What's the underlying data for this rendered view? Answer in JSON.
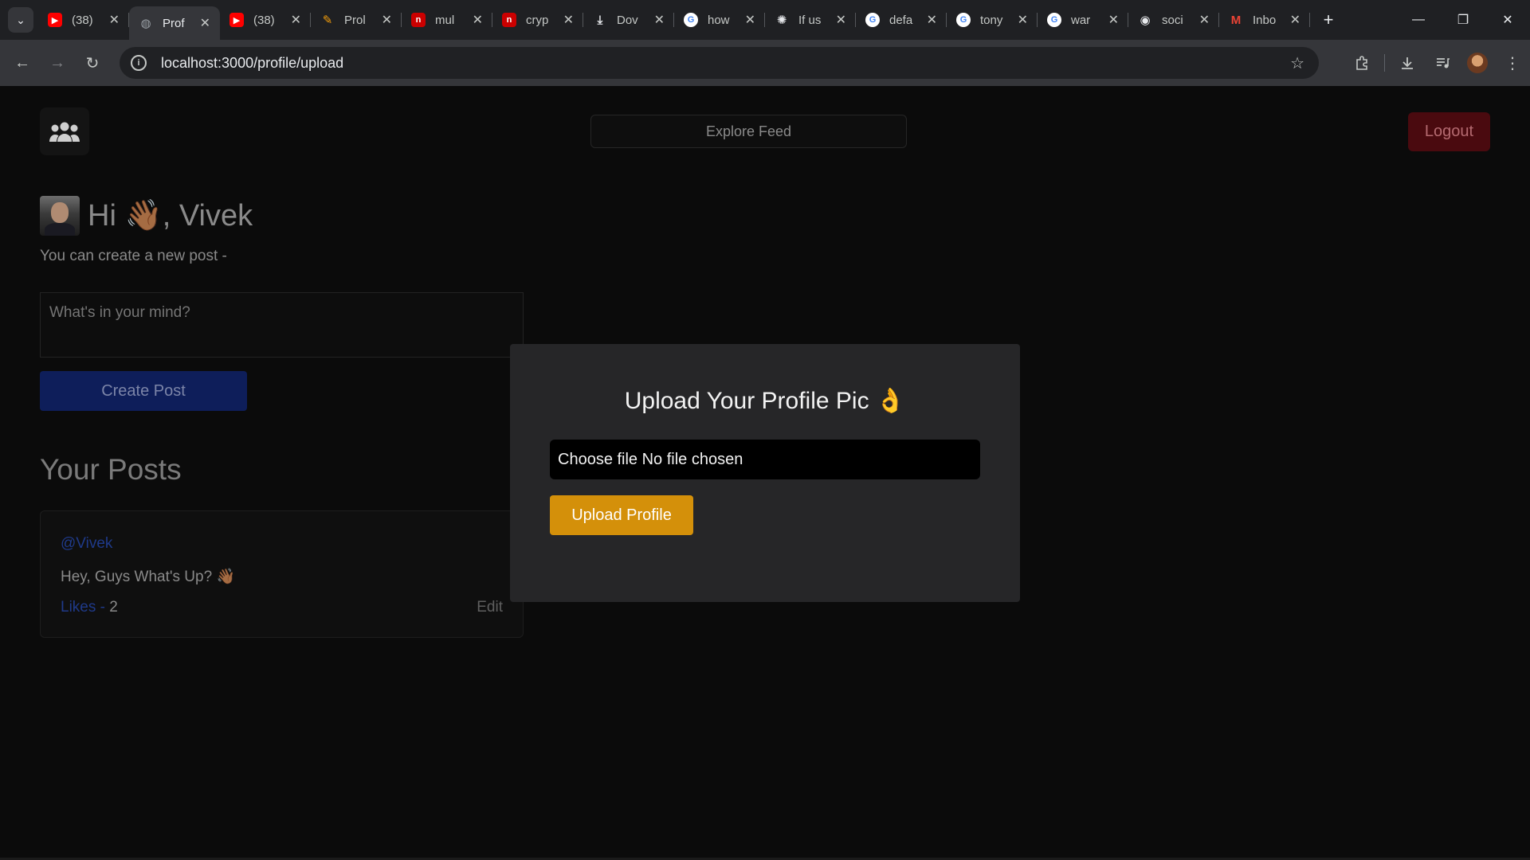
{
  "browser": {
    "tabs": [
      {
        "title": "(38)",
        "favicon": "youtube-icon",
        "color": "#ff0000"
      },
      {
        "title": "Prof",
        "favicon": "globe-icon",
        "color": "#9aa0a6",
        "active": true
      },
      {
        "title": "(38)",
        "favicon": "youtube-icon",
        "color": "#ff0000"
      },
      {
        "title": "Prol",
        "favicon": "pen-icon",
        "color": "#f59e0b"
      },
      {
        "title": "mul",
        "favicon": "npm-icon",
        "color": "#cb0000"
      },
      {
        "title": "cryp",
        "favicon": "npm-icon",
        "color": "#cb0000"
      },
      {
        "title": "Dov",
        "favicon": "download-icon",
        "color": "#e8eaed"
      },
      {
        "title": "how",
        "favicon": "google-icon",
        "color": "#4285f4"
      },
      {
        "title": "If us",
        "favicon": "chatgpt-icon",
        "color": "#e8eaed"
      },
      {
        "title": "defa",
        "favicon": "google-icon",
        "color": "#4285f4"
      },
      {
        "title": "tony",
        "favicon": "google-icon",
        "color": "#4285f4"
      },
      {
        "title": "war",
        "favicon": "google-icon",
        "color": "#4285f4"
      },
      {
        "title": "soci",
        "favicon": "github-icon",
        "color": "#e8eaed"
      },
      {
        "title": "Inbo",
        "favicon": "gmail-icon",
        "color": "#ea4335"
      }
    ],
    "url": "localhost:3000/profile/upload"
  },
  "header": {
    "explore_label": "Explore Feed",
    "logout_label": "Logout"
  },
  "greeting": {
    "text": "Hi 👋🏾, Vivek",
    "subtitle": "You can create a new post -"
  },
  "composer": {
    "placeholder": "What's in your mind?",
    "create_label": "Create Post"
  },
  "posts": {
    "heading": "Your Posts",
    "items": [
      {
        "username": "@Vivek",
        "content": "Hey, Guys What's Up? 👋🏾",
        "likes_label": "Likes -",
        "likes_count": "2",
        "edit_label": "Edit"
      }
    ]
  },
  "modal": {
    "title": "Upload Your Profile Pic 👌",
    "file_label": "Choose file No file chosen",
    "upload_label": "Upload Profile",
    "accent": "#d4900a"
  }
}
